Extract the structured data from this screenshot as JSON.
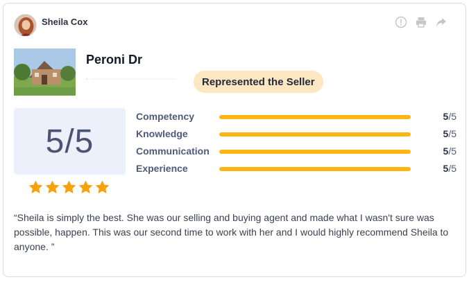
{
  "reviewer": {
    "name": "Sheila Cox"
  },
  "actions": [
    {
      "icon": "info-icon"
    },
    {
      "icon": "print-icon"
    },
    {
      "icon": "share-icon"
    }
  ],
  "property": {
    "name": "Peroni Dr"
  },
  "badge": {
    "label": "Represented the Seller"
  },
  "overall": {
    "score": "5/5",
    "stars": 5
  },
  "ratings": [
    {
      "label": "Competency",
      "score": "5",
      "max": "/5",
      "fraction": 1.0
    },
    {
      "label": "Knowledge",
      "score": "5",
      "max": "/5",
      "fraction": 1.0
    },
    {
      "label": "Communication",
      "score": "5",
      "max": "/5",
      "fraction": 1.0
    },
    {
      "label": "Experience",
      "score": "5",
      "max": "/5",
      "fraction": 1.0
    }
  ],
  "review": {
    "text": "“Sheila is simply the best. She was our selling and buying agent and made what I wasn't sure was possible, happen. This was our second time to work with her and I would highly recommend Sheila to anyone. ”"
  },
  "colors": {
    "accent": "#fbb614",
    "badge_bg": "#fde6c2",
    "score_bg": "#ecf0fa",
    "star": "#f6a10a"
  }
}
